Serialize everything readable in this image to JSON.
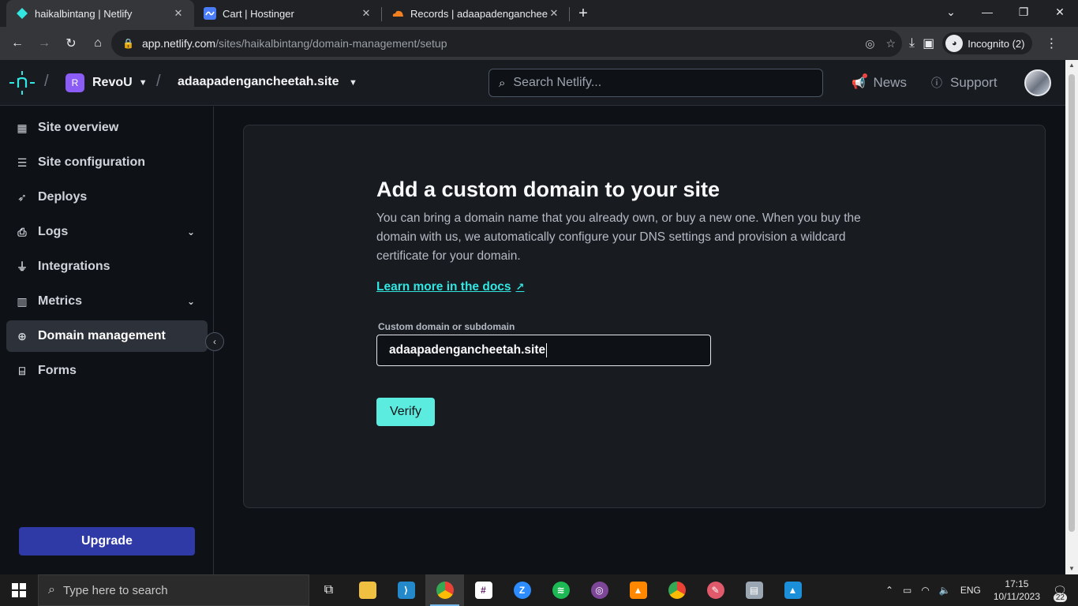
{
  "browser": {
    "tabs": [
      {
        "title": "haikalbintang | Netlify",
        "active": true,
        "icon": "netlify-diamond-icon",
        "color": "#32e6e2"
      },
      {
        "title": "Cart | Hostinger",
        "active": false,
        "icon": "hostinger-icon",
        "color": "#673de6"
      },
      {
        "title": "Records | adaapadengancheetah.site",
        "active": false,
        "icon": "cloudflare-icon",
        "color": "#f38020"
      }
    ],
    "new_tab_symbol": "+",
    "url_host": "app.netlify.com",
    "url_path": "/sites/haikalbintang/domain-management/setup",
    "incognito_label": "Incognito (2)"
  },
  "header": {
    "team_initial": "R",
    "team_name": "RevoU",
    "site_name": "adaapadengancheetah.site",
    "search_placeholder": "Search Netlify...",
    "news_label": "News",
    "support_label": "Support"
  },
  "sidebar": {
    "items": [
      {
        "label": "Site overview",
        "icon": "grid-icon"
      },
      {
        "label": "Site configuration",
        "icon": "sliders-icon"
      },
      {
        "label": "Deploys",
        "icon": "rocket-icon"
      },
      {
        "label": "Logs",
        "icon": "log-icon",
        "expandable": true
      },
      {
        "label": "Integrations",
        "icon": "plug-icon"
      },
      {
        "label": "Metrics",
        "icon": "bar-chart-icon",
        "expandable": true
      },
      {
        "label": "Domain management",
        "icon": "globe-icon",
        "selected": true
      },
      {
        "label": "Forms",
        "icon": "form-icon"
      }
    ],
    "upgrade_label": "Upgrade"
  },
  "main": {
    "title": "Add a custom domain to your site",
    "description": "You can bring a domain name that you already own, or buy a new one. When you buy the domain with us, we automatically configure your DNS settings and provision a wildcard certificate for your domain.",
    "learn_more_label": "Learn more in the docs",
    "field_label": "Custom domain or subdomain",
    "field_value": "adaapadengancheetah.site",
    "verify_label": "Verify"
  },
  "taskbar": {
    "search_placeholder": "Type here to search",
    "language": "ENG",
    "time": "17:15",
    "date": "10/11/2023",
    "notification_count": "22"
  },
  "colors": {
    "accent": "#32e6e2",
    "verify_button": "#5cebdf",
    "upgrade_button": "#2f3aa6",
    "team_avatar": "#8b5cf6"
  }
}
